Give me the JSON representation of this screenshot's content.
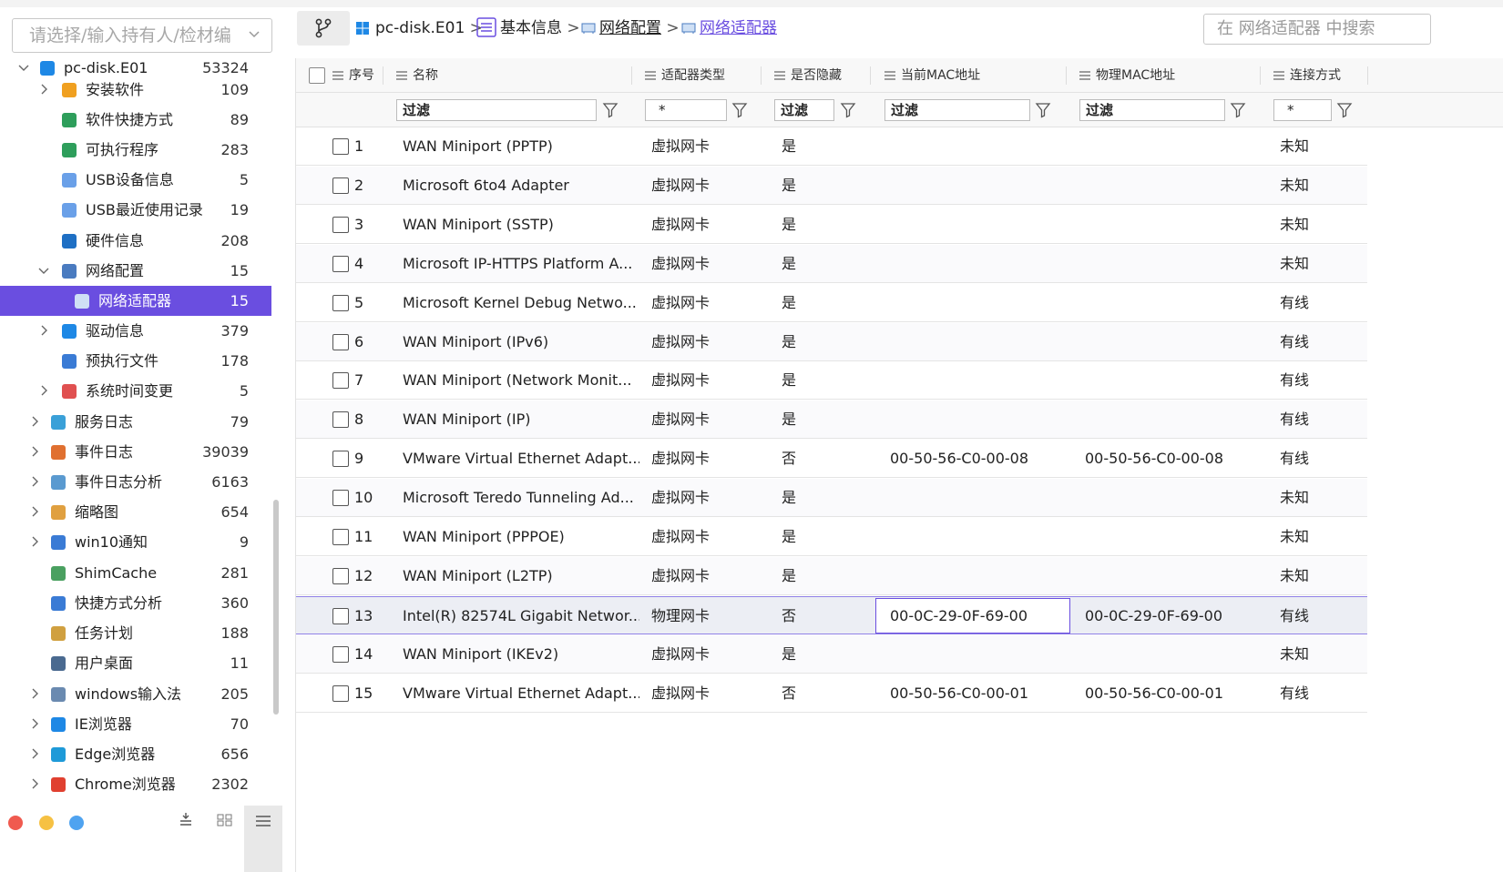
{
  "sidebar": {
    "select_placeholder": "请选择/输入持有人/检材编",
    "tree": [
      {
        "label": "pc-disk.E01",
        "count": "53324",
        "icon": "windows-icon",
        "expanded": true
      },
      {
        "label": "安装软件",
        "count": "109",
        "icon": "package-icon"
      },
      {
        "label": "软件快捷方式",
        "count": "89",
        "icon": "list-icon"
      },
      {
        "label": "可执行程序",
        "count": "283",
        "icon": "list-icon"
      },
      {
        "label": "USB设备信息",
        "count": "5",
        "icon": "usb-icon"
      },
      {
        "label": "USB最近使用记录",
        "count": "19",
        "icon": "usb-icon"
      },
      {
        "label": "硬件信息",
        "count": "208",
        "icon": "chip-icon"
      },
      {
        "label": "网络配置",
        "count": "15",
        "icon": "network-icon",
        "expanded": true
      },
      {
        "label": "网络适配器",
        "count": "15",
        "icon": "network-adapter-icon",
        "selected": true
      },
      {
        "label": "驱动信息",
        "count": "379",
        "icon": "drive-icon"
      },
      {
        "label": "预执行文件",
        "count": "178",
        "icon": "file-icon"
      },
      {
        "label": "系统时间变更",
        "count": "5",
        "icon": "clock-icon"
      },
      {
        "label": "服务日志",
        "count": "79",
        "icon": "gear-icon"
      },
      {
        "label": "事件日志",
        "count": "39039",
        "icon": "event-log-icon"
      },
      {
        "label": "事件日志分析",
        "count": "6163",
        "icon": "analysis-icon"
      },
      {
        "label": "缩略图",
        "count": "654",
        "icon": "thumbnail-icon"
      },
      {
        "label": "win10通知",
        "count": "9",
        "icon": "bell-icon"
      },
      {
        "label": "ShimCache",
        "count": "281",
        "icon": "shimcache-icon"
      },
      {
        "label": "快捷方式分析",
        "count": "360",
        "icon": "shortcut-icon"
      },
      {
        "label": "任务计划",
        "count": "188",
        "icon": "task-icon"
      },
      {
        "label": "用户桌面",
        "count": "11",
        "icon": "desktop-icon"
      },
      {
        "label": "windows输入法",
        "count": "205",
        "icon": "keyboard-icon"
      },
      {
        "label": "IE浏览器",
        "count": "70",
        "icon": "ie-icon"
      },
      {
        "label": "Edge浏览器",
        "count": "656",
        "icon": "edge-icon"
      },
      {
        "label": "Chrome浏览器",
        "count": "2302",
        "icon": "chrome-icon"
      }
    ]
  },
  "breadcrumb": {
    "items": [
      {
        "label": "pc-disk.E01",
        "icon": "windows-icon"
      },
      {
        "label": "基本信息",
        "icon": "list-icon"
      },
      {
        "label": "网络配置",
        "icon": "network-icon"
      },
      {
        "label": "网络适配器",
        "icon": "network-adapter-icon"
      }
    ],
    "separator": ">"
  },
  "search": {
    "placeholder": "在 网络适配器 中搜索"
  },
  "grid": {
    "columns": [
      "序号",
      "名称",
      "适配器类型",
      "是否隐藏",
      "当前MAC地址",
      "物理MAC地址",
      "连接方式"
    ],
    "filters": [
      "过滤",
      "*",
      "过滤",
      "过滤",
      "过滤",
      "*"
    ],
    "rows": [
      [
        "1",
        "WAN Miniport (PPTP)",
        "虚拟网卡",
        "是",
        "",
        "",
        "未知"
      ],
      [
        "2",
        "Microsoft 6to4 Adapter",
        "虚拟网卡",
        "是",
        "",
        "",
        "未知"
      ],
      [
        "3",
        "WAN Miniport (SSTP)",
        "虚拟网卡",
        "是",
        "",
        "",
        "未知"
      ],
      [
        "4",
        "Microsoft IP-HTTPS Platform A...",
        "虚拟网卡",
        "是",
        "",
        "",
        "未知"
      ],
      [
        "5",
        "Microsoft Kernel Debug Netwo...",
        "虚拟网卡",
        "是",
        "",
        "",
        "有线"
      ],
      [
        "6",
        "WAN Miniport (IPv6)",
        "虚拟网卡",
        "是",
        "",
        "",
        "有线"
      ],
      [
        "7",
        "WAN Miniport (Network Monit...",
        "虚拟网卡",
        "是",
        "",
        "",
        "有线"
      ],
      [
        "8",
        "WAN Miniport (IP)",
        "虚拟网卡",
        "是",
        "",
        "",
        "有线"
      ],
      [
        "9",
        "VMware Virtual Ethernet Adapt...",
        "虚拟网卡",
        "否",
        "00-50-56-C0-00-08",
        "00-50-56-C0-00-08",
        "有线"
      ],
      [
        "10",
        "Microsoft Teredo Tunneling Ad...",
        "虚拟网卡",
        "是",
        "",
        "",
        "未知"
      ],
      [
        "11",
        "WAN Miniport (PPPOE)",
        "虚拟网卡",
        "是",
        "",
        "",
        "未知"
      ],
      [
        "12",
        "WAN Miniport (L2TP)",
        "虚拟网卡",
        "是",
        "",
        "",
        "未知"
      ],
      [
        "13",
        "Intel(R) 82574L Gigabit Networ...",
        "物理网卡",
        "否",
        "00-0C-29-0F-69-00",
        "00-0C-29-0F-69-00",
        "有线"
      ],
      [
        "14",
        "WAN Miniport (IKEv2)",
        "虚拟网卡",
        "是",
        "",
        "",
        "未知"
      ],
      [
        "15",
        "VMware Virtual Ethernet Adapt...",
        "虚拟网卡",
        "否",
        "00-50-56-C0-00-01",
        "00-50-56-C0-00-01",
        "有线"
      ]
    ],
    "highlighted_row": 13
  },
  "colors": {
    "accent": "#6a4ee0",
    "window_dots": [
      "#f05a4f",
      "#f6c143",
      "#4fa3f0"
    ]
  }
}
